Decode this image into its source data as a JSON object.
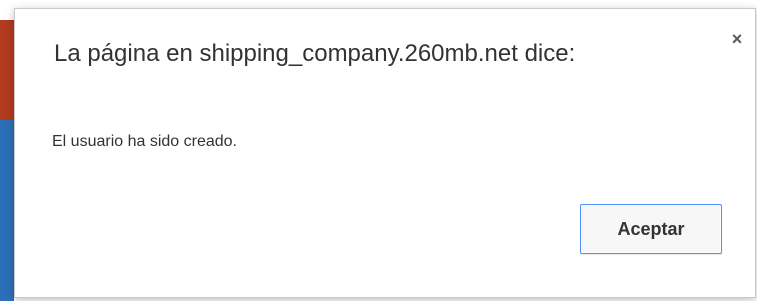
{
  "dialog": {
    "title": "La página en shipping_company.260mb.net dice:",
    "message": "El usuario ha sido creado.",
    "close_symbol": "×",
    "ok_label": "Aceptar"
  },
  "colors": {
    "focus_border": "#4d90fe",
    "text": "#333333"
  }
}
